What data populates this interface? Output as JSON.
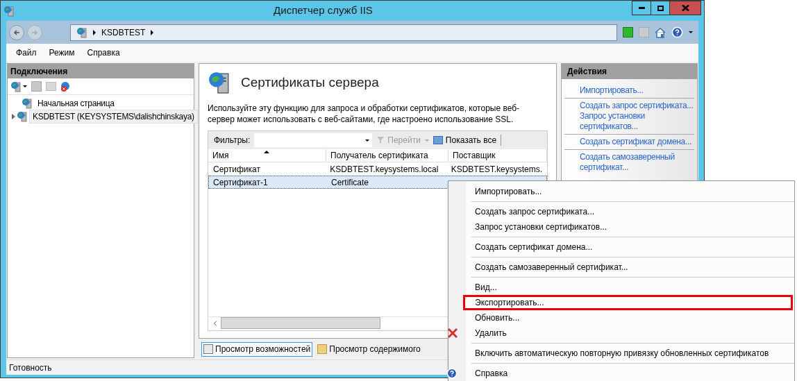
{
  "window": {
    "title": "Диспетчер служб IIS"
  },
  "address": {
    "crumbs": [
      "KSDBTEST"
    ]
  },
  "menu": [
    "Файл",
    "Режим",
    "Справка"
  ],
  "connections": {
    "title": "Подключения",
    "tree": [
      {
        "label": "Начальная страница",
        "selected": false,
        "expandable": false
      },
      {
        "label": "KSDBTEST (KEYSYSTEMS\\dalishchinskaya)",
        "selected": true,
        "expandable": true
      }
    ]
  },
  "feature": {
    "title": "Сертификаты сервера",
    "description": "Используйте эту функцию для запроса и обработки сертификатов, которые веб-сервер может использовать с веб-сайтами, где настроено использование SSL.",
    "filter_label": "Фильтры:",
    "go_button": "Перейти",
    "show_all_button": "Показать все",
    "columns": [
      {
        "label": "Имя",
        "sorted": true
      },
      {
        "label": "Получатель сертификата",
        "sorted": false
      },
      {
        "label": "Поставщик",
        "sorted": false
      }
    ],
    "rows": [
      {
        "cells": [
          "Сертификат",
          "KSDBTEST.keysystems.local",
          "KSDBTEST.keysystems."
        ],
        "selected": false
      },
      {
        "cells": [
          "Сертификат-1",
          "Certificate"
        ],
        "selected": true
      }
    ]
  },
  "view_tabs": [
    {
      "label": "Просмотр возможностей",
      "selected": true
    },
    {
      "label": "Просмотр содержимого",
      "selected": false
    }
  ],
  "actions": {
    "title": "Действия",
    "groups": [
      [
        "Импортировать..."
      ],
      [
        "Создать запрос сертификата...",
        "Запрос установки сертификатов..."
      ],
      [
        "Создать сертификат домена..."
      ],
      [
        "Создать самозаверенный сертификат..."
      ]
    ]
  },
  "context_menu": [
    [
      {
        "label": "Импортировать...",
        "kind": "plain",
        "highlighted": false
      }
    ],
    [
      {
        "label": "Создать запрос сертификата...",
        "kind": "plain",
        "highlighted": false
      },
      {
        "label": "Запрос установки сертификатов...",
        "kind": "plain",
        "highlighted": false
      }
    ],
    [
      {
        "label": "Создать сертификат домена...",
        "kind": "plain",
        "highlighted": false
      }
    ],
    [
      {
        "label": "Создать самозаверенный сертификат...",
        "kind": "plain",
        "highlighted": false
      }
    ],
    [
      {
        "label": "Вид...",
        "kind": "plain",
        "highlighted": false
      },
      {
        "label": "Экспортировать...",
        "kind": "plain",
        "highlighted": true
      },
      {
        "label": "Обновить...",
        "kind": "plain",
        "highlighted": false
      },
      {
        "label": "Удалить",
        "kind": "delete",
        "highlighted": false
      }
    ],
    [
      {
        "label": "Включить автоматическую повторную привязку обновленных сертификатов",
        "kind": "plain",
        "highlighted": false
      }
    ],
    [
      {
        "label": "Справка",
        "kind": "help",
        "highlighted": false
      }
    ]
  ],
  "status_bar": "Готовность"
}
